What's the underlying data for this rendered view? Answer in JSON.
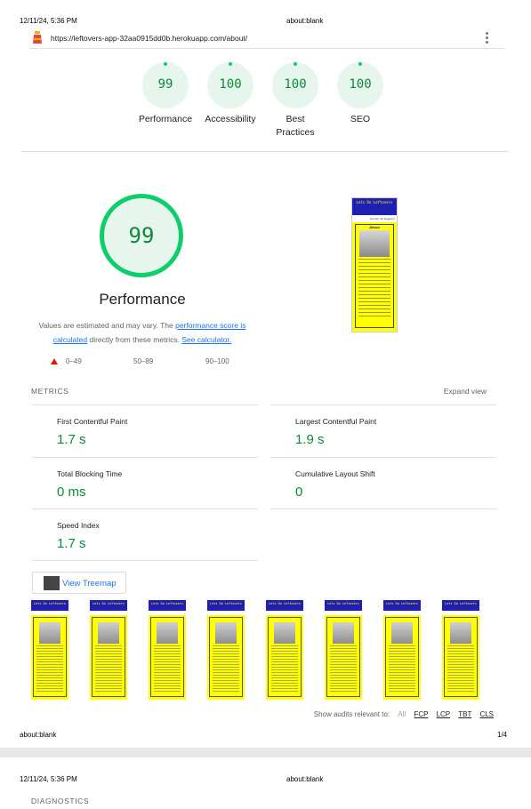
{
  "print_header": {
    "datetime": "12/11/24, 5:36 PM",
    "title": "about:blank"
  },
  "browser": {
    "url": "https://leftovers-app-32aa0915dd0b.herokuapp.com/about/",
    "favicon": "lighthouse-icon",
    "menu": "kebab-icon"
  },
  "gauges": [
    {
      "score": "99",
      "label": "Performance"
    },
    {
      "score": "100",
      "label": "Accessibility"
    },
    {
      "score": "100",
      "label": "Best Practices"
    },
    {
      "score": "100",
      "label": "SEO"
    }
  ],
  "performance": {
    "score": "99",
    "title": "Performance",
    "desc_prefix": "Values are estimated and may vary. The ",
    "link_score": "performance score is calculated",
    "desc_mid": " directly from these metrics. ",
    "link_calc": "See calculator.",
    "legend": [
      "0–49",
      "50–89",
      "90–100"
    ]
  },
  "screenshot": {
    "brand": "Lets Do Leftovers",
    "heading": "About",
    "logged_in": "You are not logged in"
  },
  "metrics": {
    "header": "METRICS",
    "expand": "Expand view",
    "items": [
      {
        "label": "First Contentful Paint",
        "value": "1.7 s"
      },
      {
        "label": "Largest Contentful Paint",
        "value": "1.9 s"
      },
      {
        "label": "Total Blocking Time",
        "value": "0 ms"
      },
      {
        "label": "Cumulative Layout Shift",
        "value": "0"
      },
      {
        "label": "Speed Index",
        "value": "1.7 s"
      }
    ]
  },
  "treemap": {
    "label": "View Treemap"
  },
  "filmstrip_count": 8,
  "audits": {
    "label": "Show audits relevant to:",
    "filters": [
      "All",
      "FCP",
      "LCP",
      "TBT",
      "CLS"
    ]
  },
  "print_footer": {
    "left": "about:blank",
    "page": "1/4"
  },
  "page2": {
    "datetime": "12/11/24, 5:36 PM",
    "title": "about:blank",
    "section": "DIAGNOSTICS"
  },
  "colors": {
    "pass": "#0cce6b",
    "pass_text": "#0c8a3a",
    "fail": "#eb0f00",
    "link": "#1a73e8"
  }
}
